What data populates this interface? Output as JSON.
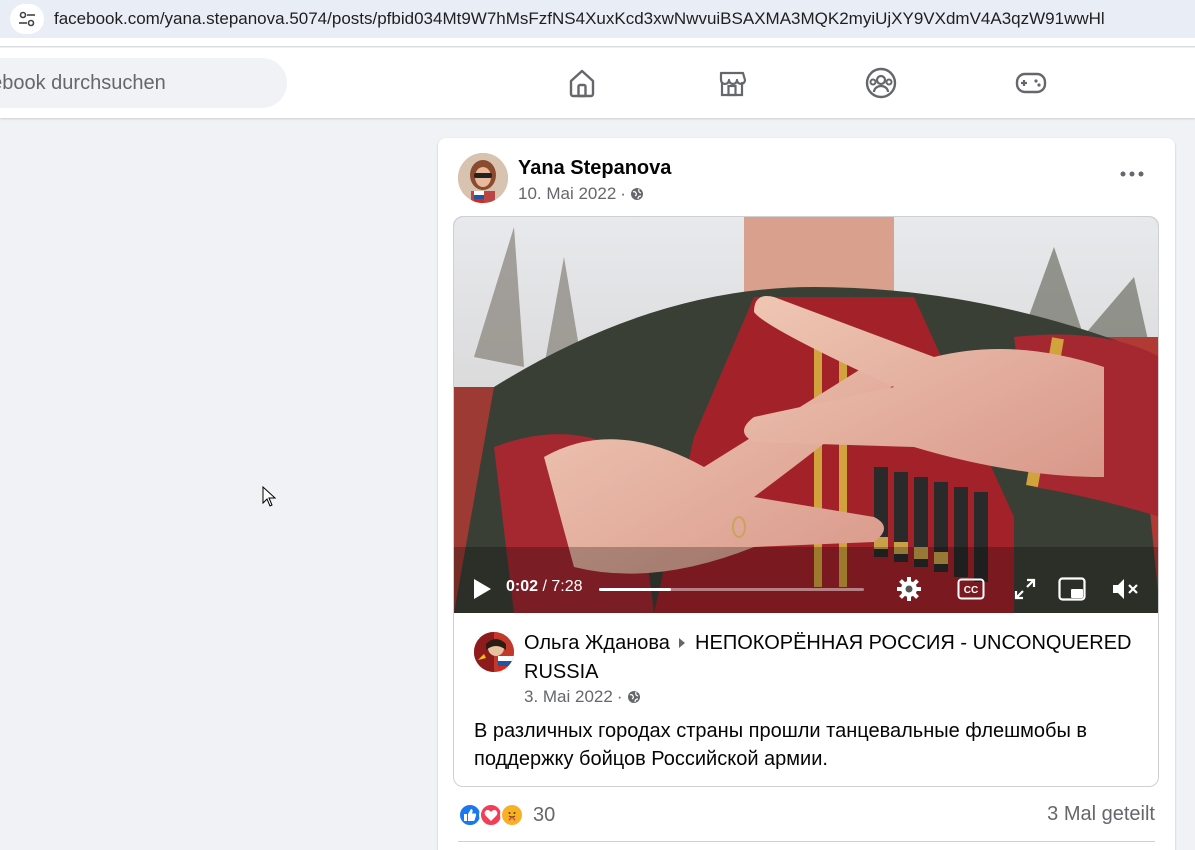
{
  "browser": {
    "url": "facebook.com/yana.stepanova.5074/posts/pfbid034Mt9W7hMsFzfNS4XuxKcd3xwNwvuiBSAXMA3MQK2myiUjXY9VXdmV4A3qzW91wwHl"
  },
  "header": {
    "search_placeholder": "acebook durchsuchen",
    "nav_icons": [
      "home-icon",
      "marketplace-icon",
      "groups-icon",
      "gaming-icon"
    ]
  },
  "post": {
    "author": "Yana Stepanova",
    "date": "10. Mai 2022",
    "separator": " · ",
    "video": {
      "current_time": "0:02",
      "total_time": " / 7:28",
      "progress_fraction": 0.27
    },
    "shared": {
      "author": "Ольга Жданова",
      "group": "НЕПОКОРЁННАЯ РОССИЯ - UNCONQUERED RUSSIA",
      "date": "3. Mai 2022",
      "separator": " · ",
      "text": "В различных городах страны прошли танцевальные флешмобы в поддержку бойцов Российской армии."
    },
    "reactions": {
      "count": "30",
      "types": [
        "like",
        "love",
        "care"
      ],
      "shares": "3 Mal geteilt"
    }
  },
  "colors": {
    "facebook_blue": "#1877f2",
    "love_red": "#f33e58",
    "care_yellow": "#f7b125",
    "secondary_text": "#65676b"
  }
}
